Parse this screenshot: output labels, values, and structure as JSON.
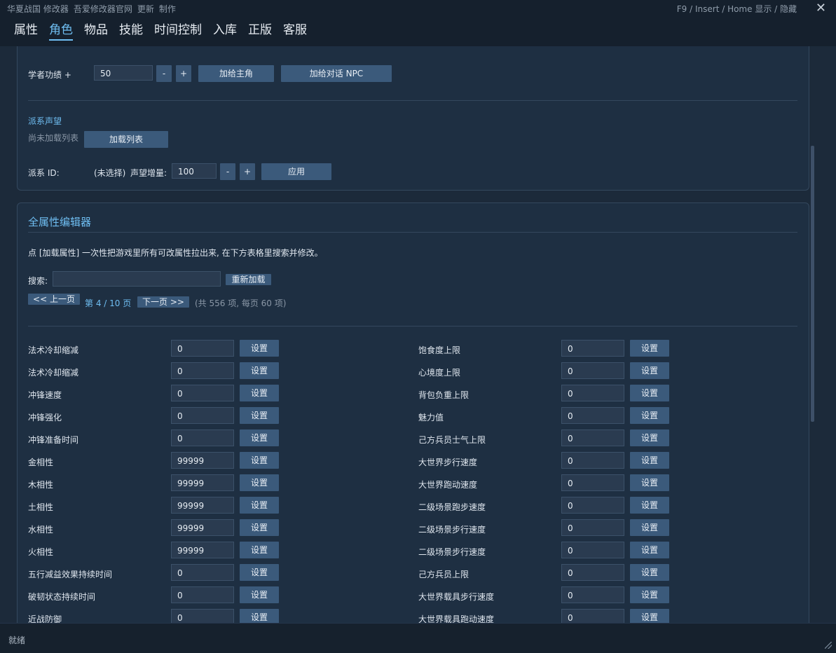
{
  "window": {
    "links": [
      "华夏战国 修改器",
      "吾爱修改器官网",
      "更新",
      "制作"
    ],
    "hotkey": "F9 / Insert / Home  显示 / 隐藏",
    "close_symbol": "✕"
  },
  "tabs": [
    "属性",
    "角色",
    "物品",
    "技能",
    "时间控制",
    "入库",
    "正版",
    "客服"
  ],
  "active_tab": "角色",
  "scholar": {
    "label": "学者功绩 +",
    "value": "50",
    "minus": "-",
    "plus": "+",
    "give_player": "加给主角",
    "give_npc": "加给对话 NPC"
  },
  "faction": {
    "title": "派系声望",
    "not_loaded": "尚未加载列表",
    "load_button": "加载列表",
    "id_label": "派系 ID:",
    "id_value": "(未选择)",
    "delta_label": "声望增量:",
    "delta_value": "100",
    "minus": "-",
    "plus": "+",
    "apply": "应用"
  },
  "editor": {
    "title": "全属性编辑器",
    "description": "点 [加载属性] 一次性把游戏里所有可改属性拉出来, 在下方表格里搜索并修改。",
    "search_label": "搜索:",
    "search_value": "",
    "reload": "重新加载",
    "prev": "<< 上一页",
    "page_info": "第 4 / 10 页",
    "next": "下一页 >>",
    "total_info": "(共 556 项, 每页 60 项)",
    "set_label": "设置",
    "left_rows": [
      {
        "name": "法术冷却缩减",
        "value": "0"
      },
      {
        "name": "法术冷却缩减",
        "value": "0"
      },
      {
        "name": "冲锋速度",
        "value": "0"
      },
      {
        "name": "冲锋强化",
        "value": "0"
      },
      {
        "name": "冲锋准备时间",
        "value": "0"
      },
      {
        "name": "金相性",
        "value": "99999"
      },
      {
        "name": "木相性",
        "value": "99999"
      },
      {
        "name": "土相性",
        "value": "99999"
      },
      {
        "name": "水相性",
        "value": "99999"
      },
      {
        "name": "火相性",
        "value": "99999"
      },
      {
        "name": "五行减益效果持续时间",
        "value": "0"
      },
      {
        "name": "破韧状态持续时间",
        "value": "0"
      },
      {
        "name": "近战防御",
        "value": "0"
      }
    ],
    "right_rows": [
      {
        "name": "饱食度上限",
        "value": "0"
      },
      {
        "name": "心境度上限",
        "value": "0"
      },
      {
        "name": "背包负重上限",
        "value": "0"
      },
      {
        "name": "魅力值",
        "value": "0"
      },
      {
        "name": "己方兵员士气上限",
        "value": "0"
      },
      {
        "name": "大世界步行速度",
        "value": "0"
      },
      {
        "name": "大世界跑动速度",
        "value": "0"
      },
      {
        "name": "二级场景跑步速度",
        "value": "0"
      },
      {
        "name": "二级场景步行速度",
        "value": "0"
      },
      {
        "name": "二级场景步行速度",
        "value": "0"
      },
      {
        "name": "己方兵员上限",
        "value": "0"
      },
      {
        "name": "大世界载具步行速度",
        "value": "0"
      },
      {
        "name": "大世界载具跑动速度",
        "value": "0"
      }
    ]
  },
  "status": "就绪",
  "colors": {
    "accent": "#6fbef2",
    "button": "#3b5a7b",
    "background": "#1c2a3a"
  }
}
